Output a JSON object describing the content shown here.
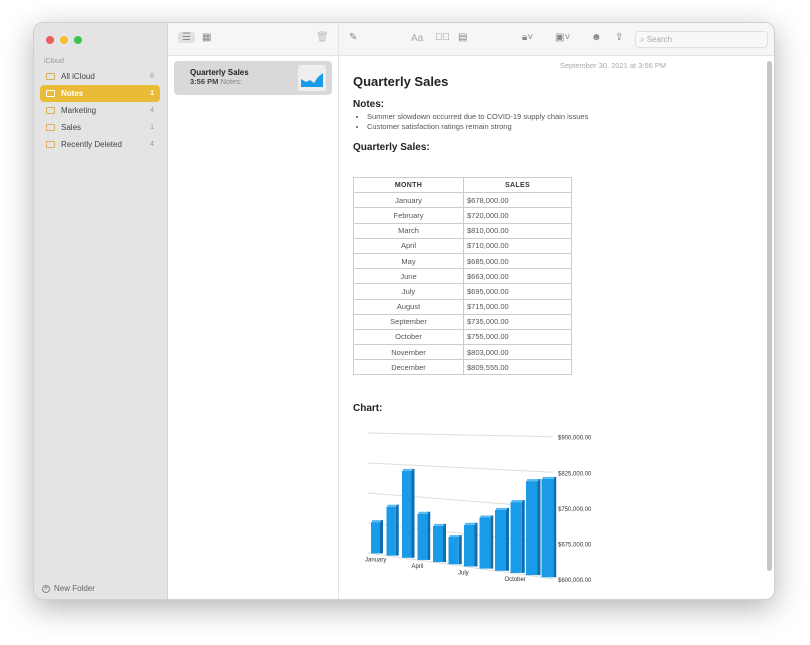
{
  "sidebar": {
    "section": "iCloud",
    "folders": [
      {
        "label": "All iCloud",
        "count": "6"
      },
      {
        "label": "Notes",
        "count": "1"
      },
      {
        "label": "Marketing",
        "count": "4"
      },
      {
        "label": "Sales",
        "count": "1"
      },
      {
        "label": "Recently Deleted",
        "count": "4"
      }
    ],
    "new_folder": "New Folder"
  },
  "note_list": {
    "items": [
      {
        "title": "Quarterly Sales",
        "time": "3:56 PM",
        "preview": "Notes:"
      }
    ]
  },
  "toolbar": {
    "format_label": "Aa",
    "search_placeholder": "Search"
  },
  "note": {
    "date": "September 30, 2021 at 3:56 PM",
    "title": "Quarterly Sales",
    "notes_heading": "Notes:",
    "bullets": [
      "Summer slowdown occurred due to COVID-19 supply chain issues",
      "Customer satisfaction ratings remain strong"
    ],
    "table_heading": "Quarterly Sales:",
    "chart_heading": "Chart:"
  },
  "table": {
    "headers": [
      "MONTH",
      "SALES"
    ],
    "rows": [
      [
        "January",
        "$678,000.00"
      ],
      [
        "February",
        "$720,000.00"
      ],
      [
        "March",
        "$810,000.00"
      ],
      [
        "April",
        "$710,000.00"
      ],
      [
        "May",
        "$685,000.00"
      ],
      [
        "June",
        "$663,000.00"
      ],
      [
        "July",
        "$695,000.00"
      ],
      [
        "August",
        "$715,000.00"
      ],
      [
        "September",
        "$735,000.00"
      ],
      [
        "October",
        "$755,000.00"
      ],
      [
        "November",
        "$803,000.00"
      ],
      [
        "December",
        "$809,555.00"
      ]
    ]
  },
  "chart_data": {
    "type": "bar",
    "categories": [
      "January",
      "February",
      "March",
      "April",
      "May",
      "June",
      "July",
      "August",
      "September",
      "October",
      "November",
      "December"
    ],
    "values": [
      678000,
      720000,
      810000,
      710000,
      685000,
      663000,
      695000,
      715000,
      735000,
      755000,
      803000,
      809555
    ],
    "ylim": [
      600000,
      900000
    ],
    "yticks": [
      "$900,000.00",
      "$825,000.00",
      "$750,000.00",
      "$675,000.00",
      "$600,000.00"
    ],
    "xticks_shown": [
      "January",
      "April",
      "July",
      "October"
    ],
    "bar_color": "#1a9be8"
  }
}
